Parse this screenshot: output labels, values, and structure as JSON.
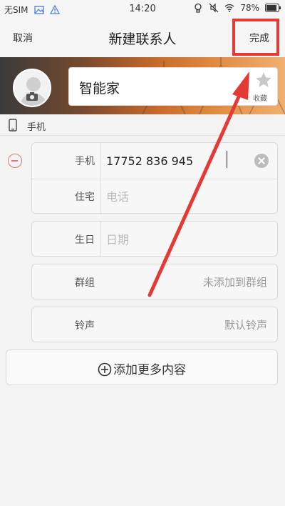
{
  "status_bar": {
    "carrier": "无SIM",
    "time": "14:20",
    "battery": "78%"
  },
  "nav": {
    "cancel": "取消",
    "title": "新建联系人",
    "done": "完成"
  },
  "contact": {
    "name": "智能家",
    "favorite_label": "收藏"
  },
  "section": {
    "label": "手机"
  },
  "phone_group": {
    "mobile_label": "手机",
    "mobile_value": "17752 836 945",
    "home_label": "住宅",
    "home_placeholder": "电话"
  },
  "birthday": {
    "label": "生日",
    "placeholder": "日期"
  },
  "group_row": {
    "label": "群组",
    "value": "未添加到群组"
  },
  "ringtone_row": {
    "label": "铃声",
    "value": "默认铃声"
  },
  "add_more": {
    "label": "添加更多内容"
  },
  "colors": {
    "highlight": "#e53935",
    "remove": "#e57373"
  }
}
